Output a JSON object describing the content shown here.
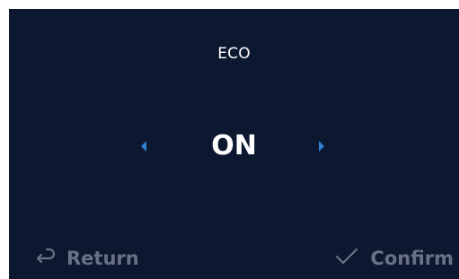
{
  "screen": {
    "title": "ECO",
    "value": "ON"
  },
  "icons": {
    "prev": "chevron-left-icon",
    "next": "chevron-right-icon",
    "return": "return-arrow-icon",
    "confirm": "check-icon"
  },
  "buttons": {
    "return_label": "Return",
    "confirm_label": "Confirm"
  },
  "colors": {
    "background": "#0c1830",
    "text": "#ffffff",
    "accent_arrow": "#2f7fd0",
    "muted": "#6a7184"
  }
}
